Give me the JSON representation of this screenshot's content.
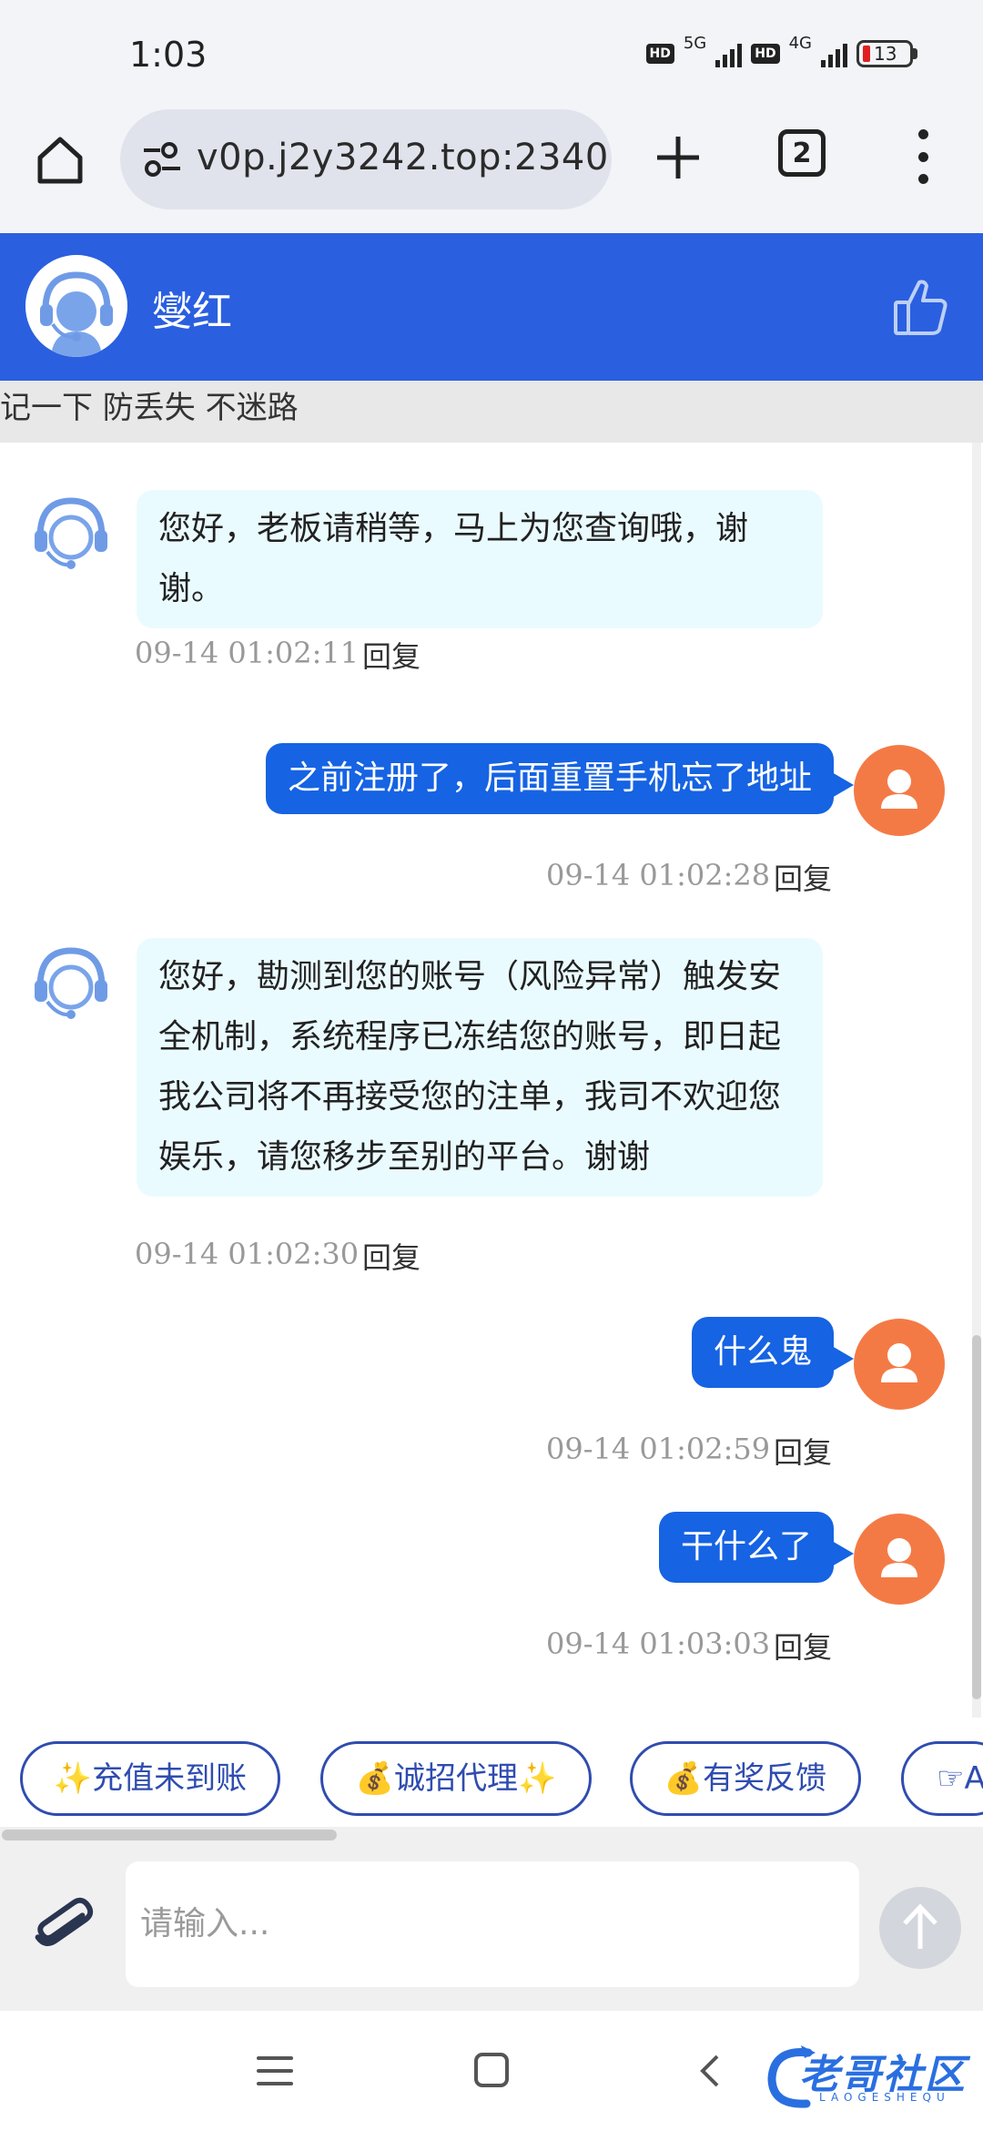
{
  "status_bar": {
    "time": "1:03",
    "sim1_badge": "HD",
    "sim1_network": "5G",
    "sim2_badge": "HD",
    "sim2_network": "4G",
    "battery_level": "13"
  },
  "browser": {
    "url": "v0p.j2y3242.top:2340",
    "tab_count": "2"
  },
  "chat_header": {
    "agent_name": "燮红"
  },
  "notice_text": "记一下 防丢失 不迷路",
  "messages": [
    {
      "side": "agent",
      "text": "您好，老板请稍等，马上为您查询哦，谢谢。",
      "time": "09-14 01:02:11",
      "reply": "回复"
    },
    {
      "side": "user",
      "text": "之前注册了，后面重置手机忘了地址",
      "time": "09-14 01:02:28",
      "reply": "回复"
    },
    {
      "side": "agent",
      "text": "您好，勘测到您的账号（风险异常）触发安全机制，系统程序已冻结您的账号，即日起我公司将不再接受您的注单，我司不欢迎您娱乐，请您移步至别的平台。谢谢",
      "time": "09-14 01:02:30",
      "reply": "回复"
    },
    {
      "side": "user",
      "text": "什么鬼",
      "time": "09-14 01:02:59",
      "reply": "回复"
    },
    {
      "side": "user",
      "text": "干什么了",
      "time": "09-14 01:03:03",
      "reply": "回复"
    }
  ],
  "quick_replies": [
    "✨充值未到账",
    "💰诚招代理✨",
    "💰有奖反馈",
    "☞A"
  ],
  "input": {
    "placeholder": "请输入..."
  },
  "watermark": {
    "text": "老哥社区",
    "sub": "LAOGESHEQU"
  },
  "colors": {
    "header_blue": "#2a5fe0",
    "user_bubble": "#1663e3",
    "agent_bubble": "#eafbff",
    "user_avatar": "#f47a45"
  }
}
